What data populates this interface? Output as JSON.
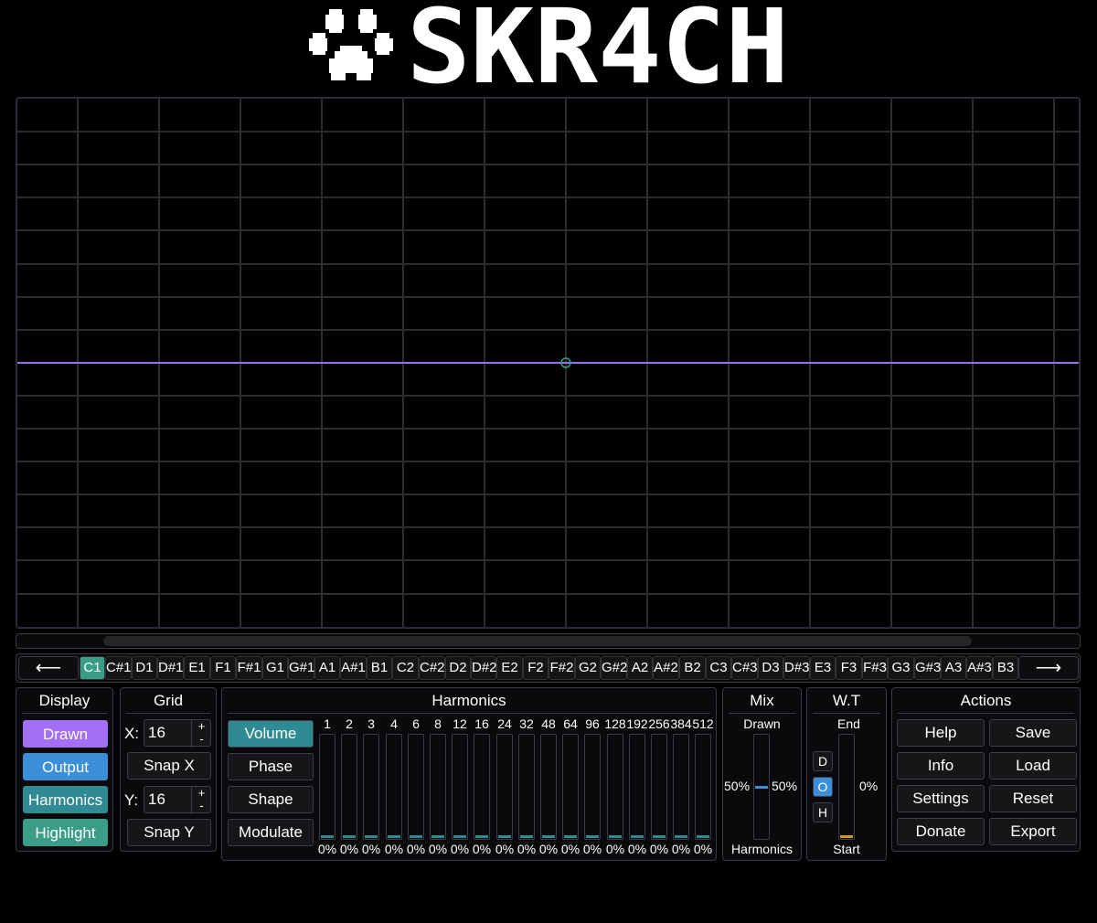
{
  "app": {
    "title": "SKR4CH",
    "logo_icon": "paw-print-icon"
  },
  "colors": {
    "drawn": "#a26ff5",
    "output": "#3b8fd8",
    "harmonics": "#2f8a94",
    "highlight": "#3a9d88",
    "wt_fill": "#c79a2e",
    "waveform": "#9d6ff0",
    "grid": "#2d2d2d"
  },
  "navigation": {
    "prev_label": "⟵",
    "next_label": "⟶"
  },
  "notes": [
    "C1",
    "C#1",
    "D1",
    "D#1",
    "E1",
    "F1",
    "F#1",
    "G1",
    "G#1",
    "A1",
    "A#1",
    "B1",
    "C2",
    "C#2",
    "D2",
    "D#2",
    "E2",
    "F2",
    "F#2",
    "G2",
    "G#2",
    "A2",
    "A#2",
    "B2",
    "C3",
    "C#3",
    "D3",
    "D#3",
    "E3",
    "F3",
    "F#3",
    "G3",
    "G#3",
    "A3",
    "A#3",
    "B3"
  ],
  "active_note": "C1",
  "display": {
    "title": "Display",
    "items": [
      {
        "label": "Drawn",
        "color": "#a26ff5"
      },
      {
        "label": "Output",
        "color": "#3b8fd8"
      },
      {
        "label": "Harmonics",
        "color": "#2f8a94"
      },
      {
        "label": "Highlight",
        "color": "#3a9d88"
      }
    ]
  },
  "grid": {
    "title": "Grid",
    "x_label": "X:",
    "x_value": "16",
    "y_label": "Y:",
    "y_value": "16",
    "plus": "+",
    "minus": "-",
    "snap_x": "Snap X",
    "snap_y": "Snap Y"
  },
  "harmonics": {
    "title": "Harmonics",
    "modes": [
      "Volume",
      "Phase",
      "Shape",
      "Modulate"
    ],
    "active_mode": "Volume",
    "columns": [
      {
        "n": "1",
        "v": "0%",
        "level": 0
      },
      {
        "n": "2",
        "v": "0%",
        "level": 0
      },
      {
        "n": "3",
        "v": "0%",
        "level": 0
      },
      {
        "n": "4",
        "v": "0%",
        "level": 0
      },
      {
        "n": "6",
        "v": "0%",
        "level": 0
      },
      {
        "n": "8",
        "v": "0%",
        "level": 0
      },
      {
        "n": "12",
        "v": "0%",
        "level": 0
      },
      {
        "n": "16",
        "v": "0%",
        "level": 0
      },
      {
        "n": "24",
        "v": "0%",
        "level": 0
      },
      {
        "n": "32",
        "v": "0%",
        "level": 0
      },
      {
        "n": "48",
        "v": "0%",
        "level": 0
      },
      {
        "n": "64",
        "v": "0%",
        "level": 0
      },
      {
        "n": "96",
        "v": "0%",
        "level": 0
      },
      {
        "n": "128",
        "v": "0%",
        "level": 0
      },
      {
        "n": "192",
        "v": "0%",
        "level": 0
      },
      {
        "n": "256",
        "v": "0%",
        "level": 0
      },
      {
        "n": "384",
        "v": "0%",
        "level": 0
      },
      {
        "n": "512",
        "v": "0%",
        "level": 0
      }
    ]
  },
  "mix": {
    "title": "Mix",
    "top_label": "Drawn",
    "bottom_label": "Harmonics",
    "left_value": "50%",
    "right_value": "50%",
    "level": 0.5
  },
  "wt": {
    "title": "W.T",
    "end_label": "End",
    "start_label": "Start",
    "value": "0%",
    "level": 0,
    "toggles": [
      {
        "label": "D",
        "on": false
      },
      {
        "label": "O",
        "on": true
      },
      {
        "label": "H",
        "on": false
      }
    ]
  },
  "actions": {
    "title": "Actions",
    "buttons": [
      "Help",
      "Save",
      "Info",
      "Load",
      "Settings",
      "Reset",
      "Donate",
      "Export"
    ]
  }
}
